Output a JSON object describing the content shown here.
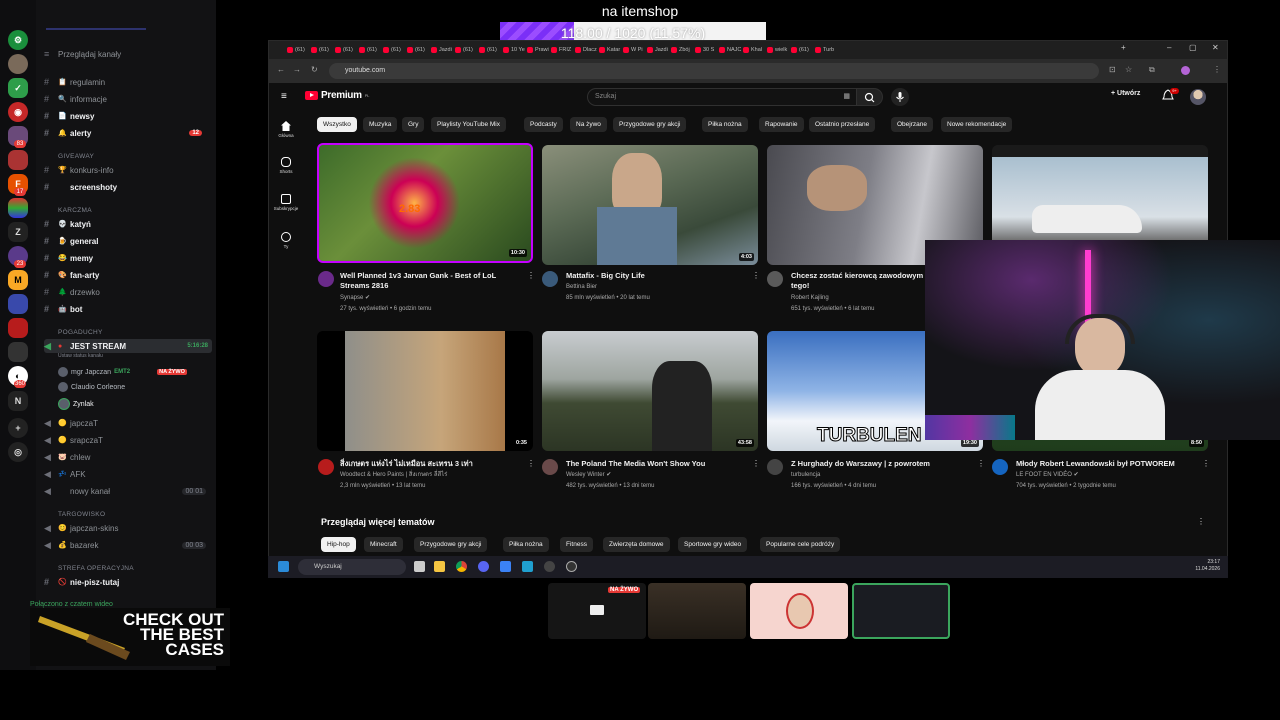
{
  "overlay": {
    "title": "na itemshop",
    "goal_text": "118.00 / 1020 (11.57%)",
    "goal_fraction": 0.1157,
    "goal_color": "#7b2ff7"
  },
  "discord": {
    "browse_channels": "Przeglądaj kanały",
    "channels": [
      {
        "name": "regulamin",
        "bold": false
      },
      {
        "name": "informacje",
        "bold": false
      },
      {
        "name": "newsy",
        "bold": true
      },
      {
        "name": "alerty",
        "bold": true,
        "badge": "12"
      }
    ],
    "cat_giveaway": "GIVEAWAY",
    "giveaway_channels": [
      "konkurs-info",
      "screenshoty"
    ],
    "cat_karczma": "KARCZMA",
    "karczma_channels": [
      "katyń",
      "general",
      "memy",
      "fan-arty",
      "drzewko",
      "bot"
    ],
    "cat_pogaduchy": "POGADUCHY",
    "live_channel": "JEST STREAM",
    "live_time": "5:16:28",
    "live_status": "Ustaw status kanału",
    "voice_users": [
      {
        "name": "mgr Japczan",
        "tag": "EMT2",
        "badge": "NA ŻYWO"
      },
      {
        "name": "Claudio Corleone"
      },
      {
        "name": "Zynlak"
      }
    ],
    "voice_channels": [
      {
        "name": "japczaT"
      },
      {
        "name": "srapczaT"
      },
      {
        "name": "chlew"
      },
      {
        "name": "AFK"
      },
      {
        "name": "nowy kanał",
        "count": "00 01"
      }
    ],
    "cat_targowisko": "TARGOWISKO",
    "targ_channels": [
      {
        "name": "japczan-skins"
      },
      {
        "name": "bazarek",
        "count": "00 03"
      }
    ],
    "cat_strefa": "STREFA OPERACYJNA",
    "strefa_channels": [
      "nie-pisz-tutaj"
    ],
    "voice_connected": "Połączono z czatem wideo",
    "server_badges": [
      "83",
      "17",
      "23",
      "360"
    ]
  },
  "ad": {
    "line1": "CHECK OUT",
    "line2": "THE BEST",
    "line3": "CASES"
  },
  "browser": {
    "url": "youtube.com",
    "tabs": [
      "(61)",
      "(61)",
      "(61)",
      "(61)",
      "(61)",
      "(61)",
      "Jazdi",
      "(61)",
      "(61)",
      "10 Ye",
      "Prawi",
      "FRIZ",
      "Dlacz",
      "Katar",
      "W Pi",
      "Jazdi",
      "Zbój",
      "30 S",
      "NAJC",
      "Khal",
      "wielk",
      "(61)",
      "Turb"
    ]
  },
  "youtube": {
    "logo": "Premium",
    "logo_region": "PL",
    "search_placeholder": "Szukaj",
    "create_label": "Utwórz",
    "notif_count": "9+",
    "guide": [
      "Główna",
      "Shorts",
      "Subskrypcje",
      "Ty"
    ],
    "chips": [
      "Wszystko",
      "Muzyka",
      "Gry",
      "Playlisty YouTube Mix",
      "Podcasty",
      "Na żywo",
      "Przygodowe gry akcji",
      "Piłka nożna",
      "Rapowanie",
      "Ostatnio przesłane",
      "Obejrzane",
      "Nowe rekomendacje"
    ],
    "videos": [
      {
        "title": "Well Planned 1v3 Jarvan Gank - Best of LoL Streams 2816",
        "channel": "Synapse",
        "meta": "27 tys. wyświetleń • 6 godzin temu",
        "duration": "10:30"
      },
      {
        "title": "Mattafix - Big City Life",
        "channel": "Bettina Bier",
        "meta": "85 mln wyświetleń • 20 lat temu",
        "duration": "4:03"
      },
      {
        "title": "Chcesz zostać kierowcą zawodowym tego!",
        "channel": "Robert Kajling",
        "meta": "651 tys. wyświetleń • 6 lat temu",
        "duration": ""
      },
      {
        "title": "",
        "channel": "",
        "meta": "",
        "duration": ""
      },
      {
        "title": "สิ่งเกษตร แห่งไร่ ไม่เหมือน สะเทรน 3 เท่า",
        "channel": "Woodtect & Hero Paints | สิ่งเกษตร ลี่สีไร่",
        "meta": "2,3 mln wyświetleń • 13 lat temu",
        "duration": "0:35"
      },
      {
        "title": "The Poland The Media Won't Show You",
        "channel": "Wesley Winter",
        "meta": "482 tys. wyświetleń • 13 dni temu",
        "duration": "43:58"
      },
      {
        "title": "Z Hurghady do Warszawy | z powrotem",
        "channel": "turbulencja",
        "meta": "166 tys. wyświetleń • 4 dni temu",
        "duration": "19:30"
      },
      {
        "title": "Młody Robert Lewandowski był POTWOREM",
        "channel": "LE FOOT EN VIDÉO",
        "meta": "704 tys. wyświetleń • 2 tygodnie temu",
        "duration": "8:50"
      }
    ],
    "thumb_overlay_text": "TURBULEN",
    "thumb_lol_text": "2.83",
    "section_title": "Przeglądaj więcej tematów",
    "topic_chips": [
      "Hip-hop",
      "Minecraft",
      "Przygodowe gry akcji",
      "Piłka nożna",
      "Fitness",
      "Zwierzęta domowe",
      "Sportowe gry wideo",
      "Popularne cele podróży"
    ]
  },
  "taskbar": {
    "search": "Wyszukaj",
    "time": "23:17",
    "date": "11.04.2026"
  },
  "stage": {
    "live_badge": "NA ŻYWO"
  }
}
